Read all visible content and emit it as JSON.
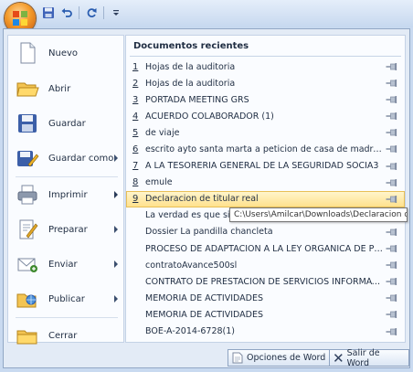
{
  "app": {
    "office_button": "office-logo",
    "quick_access": [
      {
        "name": "save-icon"
      },
      {
        "name": "undo-icon"
      },
      {
        "name": "redo-icon"
      },
      {
        "name": "customize-arrow-icon"
      }
    ]
  },
  "left_menu": {
    "items": [
      {
        "label": "Nuevo",
        "icon": "new-document-icon",
        "submenu": false
      },
      {
        "label": "Abrir",
        "icon": "open-folder-icon",
        "submenu": false
      },
      {
        "label": "Guardar",
        "icon": "save-disk-icon",
        "submenu": false
      },
      {
        "label": "Guardar como",
        "icon": "save-as-icon",
        "submenu": true
      },
      {
        "label": "Imprimir",
        "icon": "printer-icon",
        "submenu": true
      },
      {
        "label": "Preparar",
        "icon": "prepare-icon",
        "submenu": true
      },
      {
        "label": "Enviar",
        "icon": "send-icon",
        "submenu": true
      },
      {
        "label": "Publicar",
        "icon": "publish-icon",
        "submenu": true
      },
      {
        "label": "Cerrar",
        "icon": "close-folder-icon",
        "submenu": false
      }
    ]
  },
  "recent": {
    "title": "Documentos recientes",
    "documents": [
      {
        "num": "1",
        "name": "Hojas de la auditoria"
      },
      {
        "num": "2",
        "name": "Hojas de la auditoria"
      },
      {
        "num": "3",
        "name": "PORTADA MEETING GRS"
      },
      {
        "num": "4",
        "name": "ACUERDO COLABORADOR (1)"
      },
      {
        "num": "5",
        "name": "de viaje"
      },
      {
        "num": "6",
        "name": "escrito ayto santa marta a peticion de casa de madres solter..."
      },
      {
        "num": "7",
        "name": "A LA TESORERIA GENERAL DE LA SEGURIDAD SOCIA3"
      },
      {
        "num": "8",
        "name": "emule"
      },
      {
        "num": "9",
        "name": "Declaracion de titular real",
        "highlighted": true
      },
      {
        "num": "",
        "name": "La verdad es que si"
      },
      {
        "num": "",
        "name": "Dossier La pandilla chancleta"
      },
      {
        "num": "",
        "name": "PROCESO DE ADAPTACIÓN A LA LEY ORGANICA DE PROTEC..."
      },
      {
        "num": "",
        "name": "contratoAvance500sl"
      },
      {
        "num": "",
        "name": "CONTRATO DE PRESTACIÓN DE SERVICIOS INFORMÁTICOS"
      },
      {
        "num": "",
        "name": "MEMORIA DE ACTIVIDADES"
      },
      {
        "num": "",
        "name": "MEMORIA DE ACTIVIDADES"
      },
      {
        "num": "",
        "name": "BOE-A-2014-6728(1)"
      }
    ],
    "tooltip": "C:\\Users\\Amilcar\\Downloads\\Declaracion de"
  },
  "footer": {
    "options_label": "Opciones de Word",
    "exit_label": "Salir de Word"
  },
  "colors": {
    "highlight": "#ffe089",
    "frame": "#e3ebf6",
    "text": "#1f2d42"
  }
}
